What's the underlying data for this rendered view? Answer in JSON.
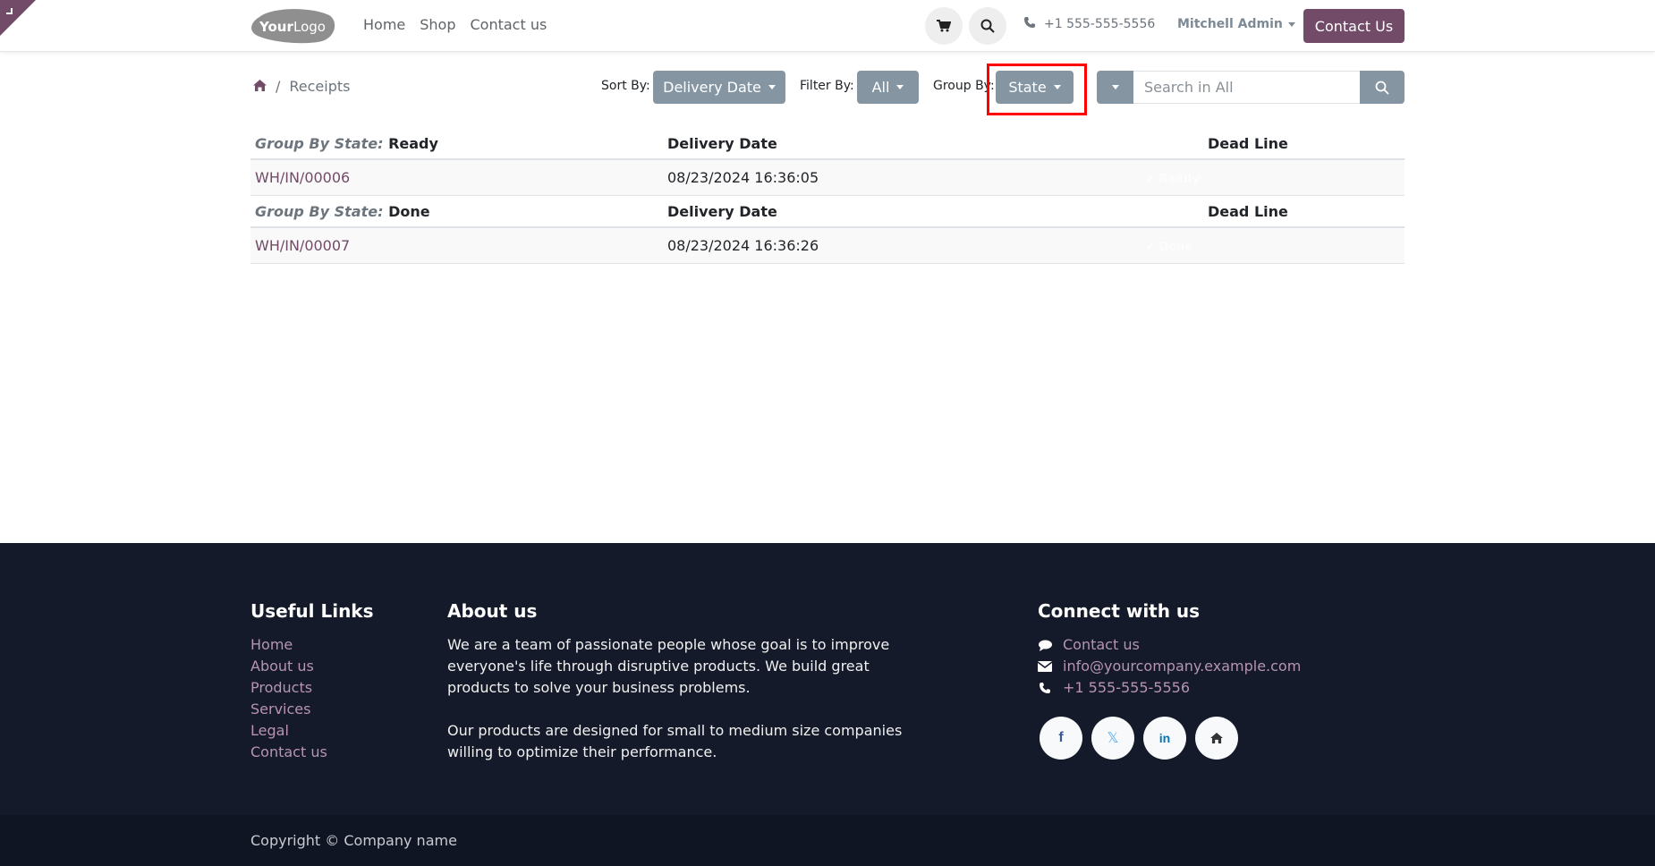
{
  "header": {
    "logo_text": "YourLogo",
    "nav": [
      "Home",
      "Shop",
      "Contact us"
    ],
    "phone": "+1 555-555-5556",
    "user": "Mitchell Admin",
    "contact_button": "Contact Us",
    "brand_color": "#714b67"
  },
  "toolbar": {
    "breadcrumb_current": "Receipts",
    "sort_label": "Sort By:",
    "sort_value": "Delivery Date",
    "filter_label": "Filter By:",
    "filter_value": "All",
    "group_label": "Group By:",
    "group_value": "State",
    "search_placeholder": "Search in All"
  },
  "table": {
    "group_prefix": "Group By State:",
    "columns": [
      "Delivery Date",
      "Dead Line"
    ],
    "groups": [
      {
        "state": "Ready",
        "rows": [
          {
            "reference": "WH/IN/00006",
            "delivery_date": "08/23/2024  16:36:05",
            "badge": "✔ Ready"
          }
        ]
      },
      {
        "state": "Done",
        "rows": [
          {
            "reference": "WH/IN/00007",
            "delivery_date": "08/23/2024  16:36:26",
            "badge": "✔ Done"
          }
        ]
      }
    ]
  },
  "footer": {
    "useful_links_title": "Useful Links",
    "useful_links": [
      "Home",
      "About us",
      "Products",
      "Services",
      "Legal",
      "Contact us"
    ],
    "about_title": "About us",
    "about_p1": "We are a team of passionate people whose goal is to improve everyone's life through disruptive products. We build great products to solve your business problems.",
    "about_p2": "Our products are designed for small to medium size companies willing to optimize their performance.",
    "connect_title": "Connect with us",
    "connect_contact": "Contact us",
    "connect_email": "info@yourcompany.example.com",
    "connect_phone": "+1 555-555-5556",
    "socials": [
      "facebook",
      "x-twitter",
      "linkedin",
      "home"
    ],
    "copyright": "Copyright © Company name"
  }
}
